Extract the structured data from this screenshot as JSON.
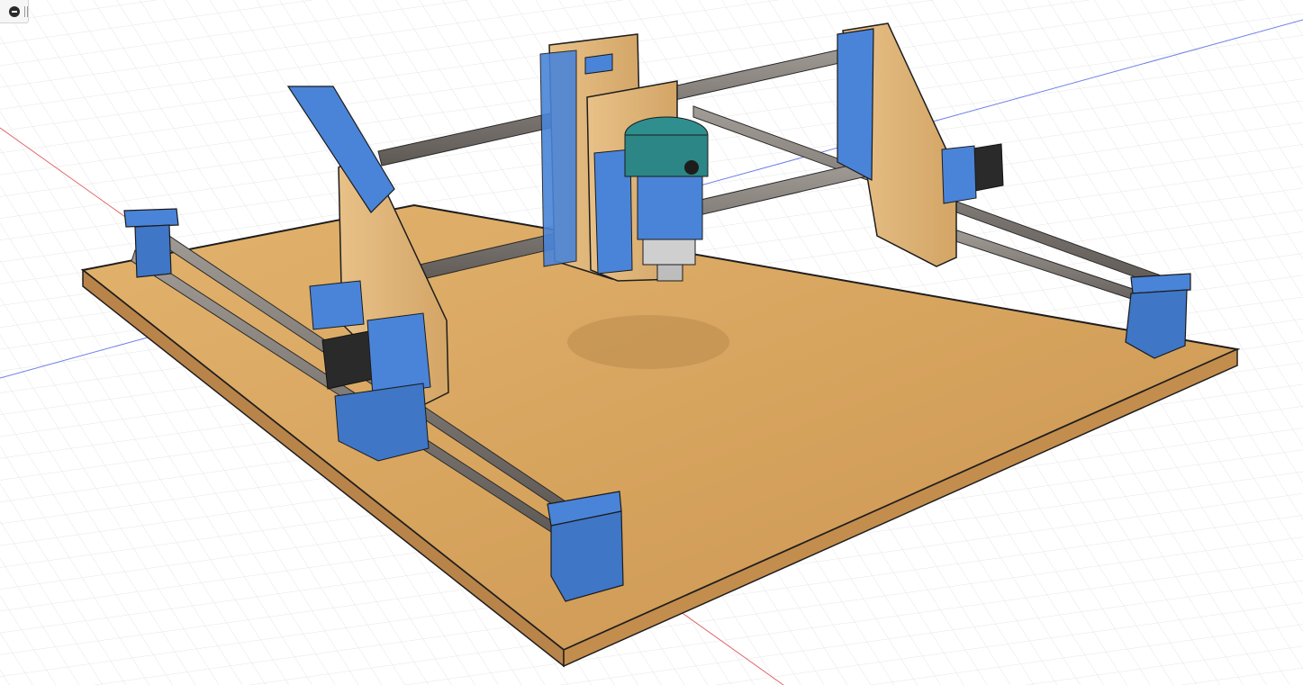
{
  "app": {
    "name": "",
    "browser_toggle": {
      "icon": "collapse-minus-icon"
    }
  },
  "viewport": {
    "background": "#ffffff",
    "grid_color": "#dcdcdc",
    "x_axis_color": "#e06666",
    "y_axis_color": "#6f7fe6",
    "model": {
      "base_color": "#d9a762",
      "part_color": "#4a84d8",
      "rail_color": "#8b8581",
      "motor_color": "#2a2a2a",
      "router_color": "#2f8f8f"
    }
  }
}
